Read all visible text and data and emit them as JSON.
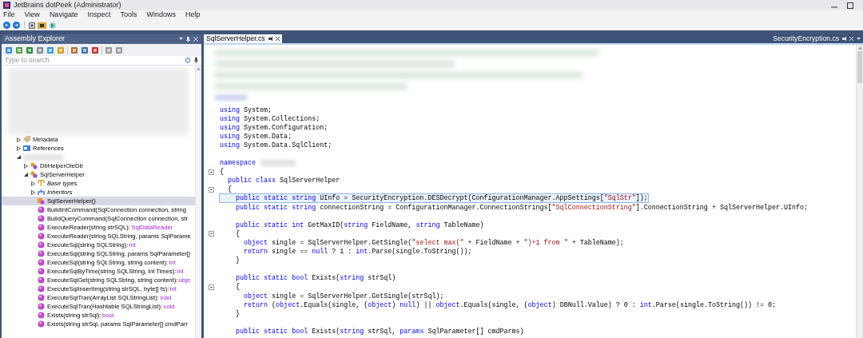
{
  "window": {
    "title": "JetBrains dotPeek (Administrator)"
  },
  "menu": [
    "File",
    "View",
    "Navigate",
    "Inspect",
    "Tools",
    "Windows",
    "Help"
  ],
  "explorer": {
    "title": "Assembly Explorer",
    "search": {
      "placeholder": "Type to search"
    },
    "tree": [
      {
        "kind": "metadata",
        "name": "Metadata",
        "expanded": false,
        "selected": false
      },
      {
        "kind": "references",
        "name": "References",
        "expanded": false,
        "selected": false
      },
      {
        "kind": "hidden",
        "expanded": true,
        "selected": false,
        "children": [
          {
            "kind": "class",
            "name": "DbHelperOleDb",
            "expanded": false,
            "selected": false
          },
          {
            "kind": "class",
            "name": "SqlServerHelper",
            "expanded": true,
            "selected": false,
            "children": [
              {
                "kind": "basetypes",
                "name": "Base types",
                "expanded": false,
                "selected": false
              },
              {
                "kind": "inheritors",
                "name": "Inheritors",
                "expanded": false,
                "selected": false
              },
              {
                "kind": "ctor",
                "name": "SqlServerHelper()",
                "selected": true
              },
              {
                "kind": "method",
                "name": "BuildIntCommand(SqlConnection connection, string",
                "selected": false
              },
              {
                "kind": "method",
                "name": "BuildQueryCommand(SqlConnection connection, str",
                "selected": false
              },
              {
                "kind": "method",
                "name": "ExecuteReader(string strSQL):",
                "type": "SqlDataReader",
                "selected": false
              },
              {
                "kind": "method",
                "name": "ExecuteReader(string SQLString, params SqlParame",
                "selected": false
              },
              {
                "kind": "method",
                "name": "ExecuteSql(string SQLString):",
                "type": "int",
                "selected": false
              },
              {
                "kind": "method",
                "name": "ExecuteSql(string SQLString, params SqlParameter[]",
                "selected": false
              },
              {
                "kind": "method",
                "name": "ExecuteSql(string SQLString, string content):",
                "type": "int",
                "selected": false
              },
              {
                "kind": "method",
                "name": "ExecuteSqlByTime(string SQLString, int Times):",
                "type": "int",
                "selected": false
              },
              {
                "kind": "method",
                "name": "ExecuteSqlGet(string SQLString, string content):",
                "type": "obje",
                "selected": false
              },
              {
                "kind": "method",
                "name": "ExecuteSqlInsertImg(string strSQL, byte[] fs):",
                "type": "int",
                "selected": false
              },
              {
                "kind": "method",
                "name": "ExecuteSqlTran(ArrayList SQLStringList):",
                "type": "void",
                "selected": false
              },
              {
                "kind": "method",
                "name": "ExecuteSqlTran(Hashtable SQLStringList):",
                "type": "void",
                "selected": false
              },
              {
                "kind": "method",
                "name": "Exists(string strSql):",
                "type": "bool",
                "selected": false
              },
              {
                "kind": "method",
                "name": "Exists(string strSql, params SqlParameter[] cmdParr",
                "selected": false
              }
            ]
          }
        ]
      }
    ]
  },
  "tabs": [
    {
      "label": "SqlServerHelper.cs",
      "selected": true
    },
    {
      "label": "SecurityEncryption.cs",
      "selected": false
    }
  ],
  "code": [
    {
      "kind": "code",
      "fold": false,
      "highlighted": false,
      "tokens": [
        {
          "kind": "kw",
          "text": "using"
        },
        {
          "kind": "plain",
          "text": " System;"
        }
      ]
    },
    {
      "kind": "code",
      "fold": false,
      "highlighted": false,
      "tokens": [
        {
          "kind": "kw",
          "text": "using"
        },
        {
          "kind": "plain",
          "text": " System.Collections;"
        }
      ]
    },
    {
      "kind": "code",
      "fold": false,
      "highlighted": false,
      "tokens": [
        {
          "kind": "kw",
          "text": "using"
        },
        {
          "kind": "plain",
          "text": " System.Configuration;"
        }
      ]
    },
    {
      "kind": "code",
      "fold": false,
      "highlighted": false,
      "tokens": [
        {
          "kind": "kw",
          "text": "using"
        },
        {
          "kind": "plain",
          "text": " System.Data;"
        }
      ]
    },
    {
      "kind": "code",
      "fold": false,
      "highlighted": false,
      "tokens": [
        {
          "kind": "kw",
          "text": "using"
        },
        {
          "kind": "plain",
          "text": " System.Data.SqlClient;"
        }
      ]
    },
    {
      "kind": "blank"
    },
    {
      "kind": "code",
      "fold": false,
      "highlighted": false,
      "tokens": [
        {
          "kind": "kw",
          "text": "namespace"
        },
        {
          "kind": "blur"
        }
      ]
    },
    {
      "kind": "code",
      "fold": true,
      "highlighted": false,
      "tokens": [
        {
          "kind": "plain",
          "text": "{"
        }
      ]
    },
    {
      "kind": "code",
      "fold": false,
      "highlighted": false,
      "tokens": [
        {
          "kind": "kw",
          "text": "  public class"
        },
        {
          "kind": "plain",
          "text": " SqlServerHelper"
        }
      ]
    },
    {
      "kind": "code",
      "fold": true,
      "highlighted": false,
      "tokens": [
        {
          "kind": "plain",
          "text": "  {"
        }
      ]
    },
    {
      "kind": "code",
      "fold": false,
      "highlighted": true,
      "tokens": [
        {
          "kind": "kw",
          "text": "    public static string"
        },
        {
          "kind": "plain",
          "text": " UInfo = SecurityEncryption.DESDecrypt(ConfigurationManager.AppSettings["
        },
        {
          "kind": "str",
          "text": "\"SqlStr\""
        },
        {
          "kind": "plain",
          "text": "]);"
        }
      ]
    },
    {
      "kind": "code",
      "fold": false,
      "highlighted": false,
      "tokens": [
        {
          "kind": "kw",
          "text": "    public static string"
        },
        {
          "kind": "plain",
          "text": " connectionString = ConfigurationManager.ConnectionStrings["
        },
        {
          "kind": "str",
          "text": "\"SqlConnectionString\""
        },
        {
          "kind": "plain",
          "text": "].ConnectionString + SqlServerHelper.UInfo;"
        }
      ]
    },
    {
      "kind": "blank"
    },
    {
      "kind": "code",
      "fold": false,
      "highlighted": false,
      "tokens": [
        {
          "kind": "kw",
          "text": "    public static int"
        },
        {
          "kind": "plain",
          "text": " GetMaxID("
        },
        {
          "kind": "kw",
          "text": "string"
        },
        {
          "kind": "plain",
          "text": " FieldName, "
        },
        {
          "kind": "kw",
          "text": "string"
        },
        {
          "kind": "plain",
          "text": " TableName)"
        }
      ]
    },
    {
      "kind": "code",
      "fold": true,
      "highlighted": false,
      "tokens": [
        {
          "kind": "plain",
          "text": "    {"
        }
      ]
    },
    {
      "kind": "code",
      "fold": false,
      "highlighted": false,
      "tokens": [
        {
          "kind": "kw",
          "text": "      object"
        },
        {
          "kind": "plain",
          "text": " single = SqlServerHelper.GetSingle("
        },
        {
          "kind": "str",
          "text": "\"select max(\""
        },
        {
          "kind": "plain",
          "text": " + FieldName + "
        },
        {
          "kind": "str",
          "text": "\")+1 from \""
        },
        {
          "kind": "plain",
          "text": " + TableName);"
        }
      ]
    },
    {
      "kind": "code",
      "fold": false,
      "highlighted": false,
      "tokens": [
        {
          "kind": "kw",
          "text": "      return"
        },
        {
          "kind": "plain",
          "text": " single == "
        },
        {
          "kind": "kw",
          "text": "null"
        },
        {
          "kind": "plain",
          "text": " ? 1 : "
        },
        {
          "kind": "kw",
          "text": "int"
        },
        {
          "kind": "plain",
          "text": ".Parse(single.ToString());"
        }
      ]
    },
    {
      "kind": "code",
      "fold": false,
      "highlighted": false,
      "tokens": [
        {
          "kind": "plain",
          "text": "    }"
        }
      ]
    },
    {
      "kind": "blank"
    },
    {
      "kind": "code",
      "fold": false,
      "highlighted": false,
      "tokens": [
        {
          "kind": "kw",
          "text": "    public static bool"
        },
        {
          "kind": "plain",
          "text": " Exists("
        },
        {
          "kind": "kw",
          "text": "string"
        },
        {
          "kind": "plain",
          "text": " strSql)"
        }
      ]
    },
    {
      "kind": "code",
      "fold": true,
      "highlighted": false,
      "tokens": [
        {
          "kind": "plain",
          "text": "    {"
        }
      ]
    },
    {
      "kind": "code",
      "fold": false,
      "highlighted": false,
      "tokens": [
        {
          "kind": "kw",
          "text": "      object"
        },
        {
          "kind": "plain",
          "text": " single = SqlServerHelper.GetSingle(strSql);"
        }
      ]
    },
    {
      "kind": "code",
      "fold": false,
      "highlighted": false,
      "tokens": [
        {
          "kind": "kw",
          "text": "      return"
        },
        {
          "kind": "plain",
          "text": " ("
        },
        {
          "kind": "kw",
          "text": "object"
        },
        {
          "kind": "plain",
          "text": ".Equals(single, ("
        },
        {
          "kind": "kw",
          "text": "object"
        },
        {
          "kind": "plain",
          "text": ") "
        },
        {
          "kind": "kw",
          "text": "null"
        },
        {
          "kind": "plain",
          "text": ") || "
        },
        {
          "kind": "kw",
          "text": "object"
        },
        {
          "kind": "plain",
          "text": ".Equals(single, ("
        },
        {
          "kind": "kw",
          "text": "object"
        },
        {
          "kind": "plain",
          "text": ") DBNull.Value) ? 0 : "
        },
        {
          "kind": "kw",
          "text": "int"
        },
        {
          "kind": "plain",
          "text": ".Parse(single.ToString()) != 0;"
        }
      ]
    },
    {
      "kind": "code",
      "fold": false,
      "highlighted": false,
      "tokens": [
        {
          "kind": "plain",
          "text": "    }"
        }
      ]
    },
    {
      "kind": "blank"
    },
    {
      "kind": "code",
      "fold": false,
      "highlighted": false,
      "tokens": [
        {
          "kind": "kw",
          "text": "    public static bool"
        },
        {
          "kind": "plain",
          "text": " Exists("
        },
        {
          "kind": "kw",
          "text": "string"
        },
        {
          "kind": "plain",
          "text": " strSql, "
        },
        {
          "kind": "kw",
          "text": "params"
        },
        {
          "kind": "plain",
          "text": " SqlParameter[] cmdParms)"
        }
      ]
    }
  ]
}
